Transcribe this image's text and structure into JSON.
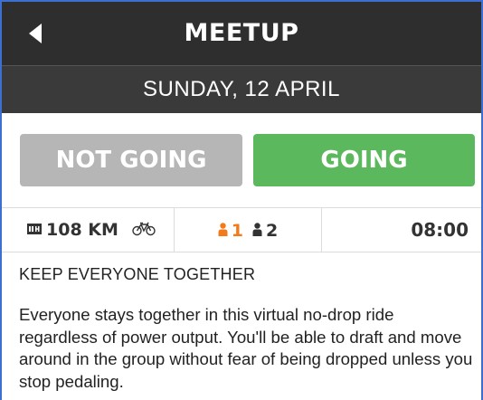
{
  "header": {
    "title": "MEETUP",
    "back_icon": "back-arrow-icon"
  },
  "date": {
    "text": "SUNDAY, 12 APRIL"
  },
  "actions": {
    "not_going_label": "NOT GOING",
    "going_label": "GOING",
    "not_going_color": "#b6b6b6",
    "going_color": "#5cb85c"
  },
  "stats": {
    "distance": "108 KM",
    "distance_icon": "distance-icon",
    "sport_icon": "bicycle-icon",
    "riders_going": "1",
    "riders_invited": "2",
    "going_color": "#f27a1a",
    "start_time": "08:00"
  },
  "description": {
    "heading": "KEEP EVERYONE TOGETHER",
    "body": "Everyone stays together in this virtual no-drop ride regardless of power output. You'll be able to draft and move around in the group without fear of being dropped unless you stop pedaling."
  }
}
